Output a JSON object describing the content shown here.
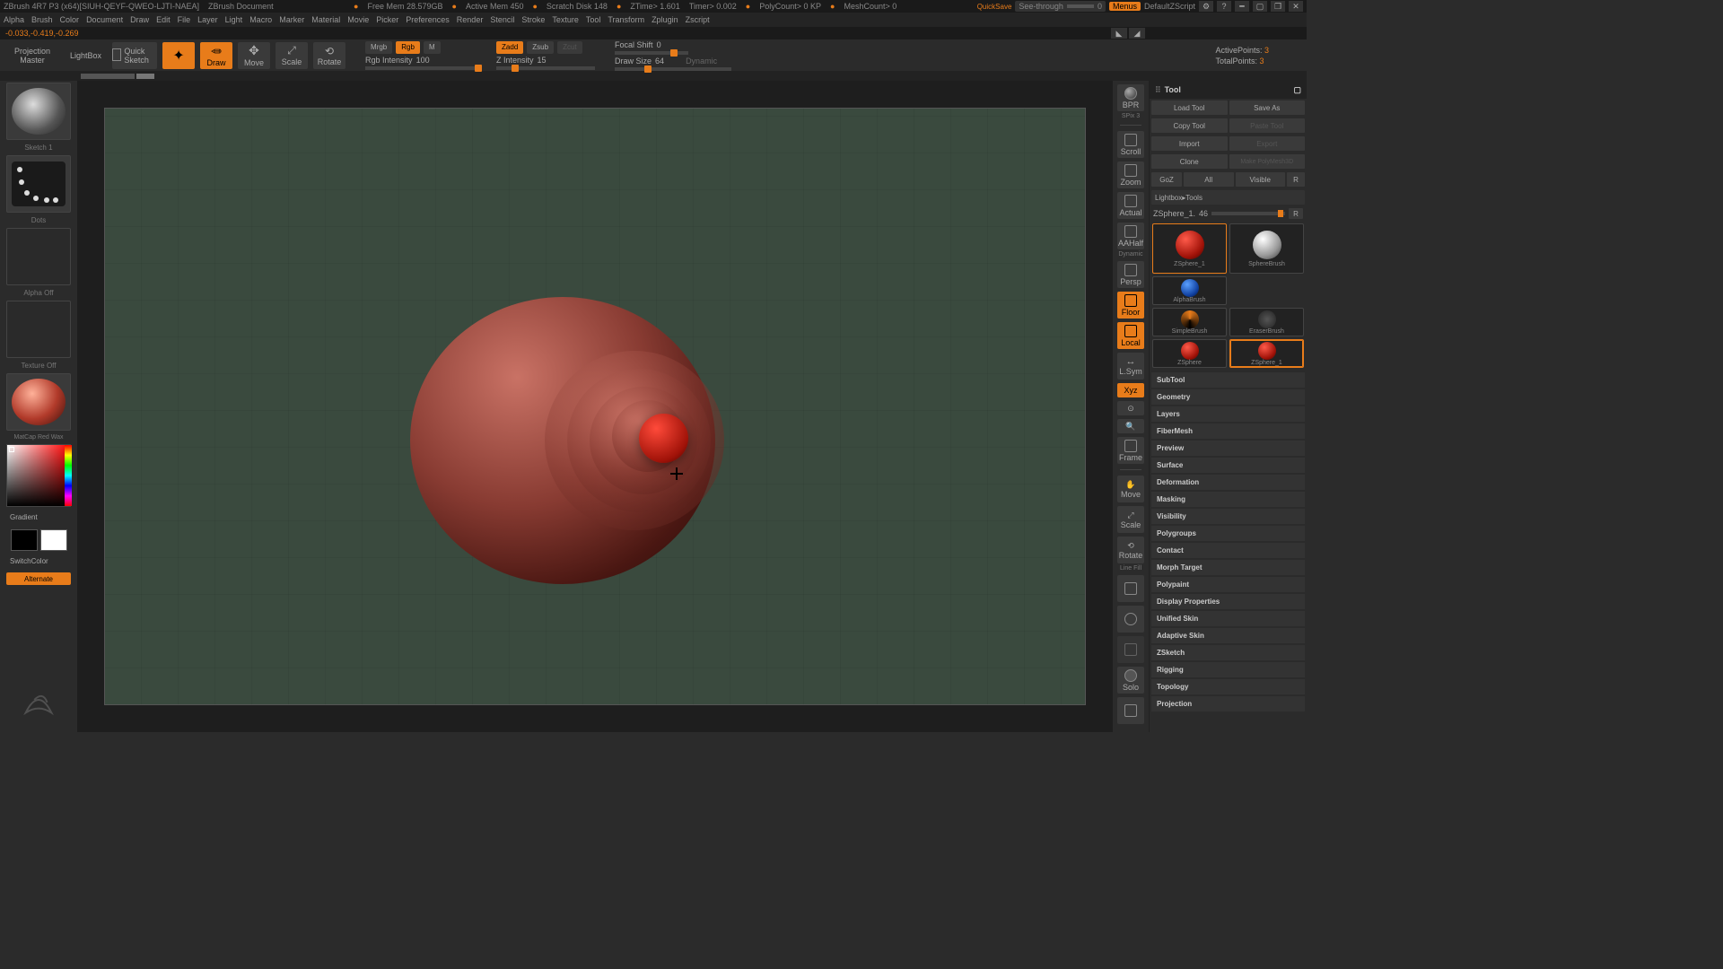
{
  "titlebar": {
    "app": "ZBrush 4R7 P3 (x64)[SIUH-QEYF-QWEO-LJTI-NAEA]",
    "doc": "ZBrush Document",
    "freeMem": "Free Mem 28.579GB",
    "activeMem": "Active Mem 450",
    "scratch": "Scratch Disk 148",
    "ztime": "ZTime> 1.601",
    "timer": "Timer> 0.002",
    "poly": "PolyCount> 0 KP",
    "mesh": "MeshCount> 0",
    "quicksave": "QuickSave",
    "seeThrough": "See-through",
    "seeThroughVal": "0",
    "menus": "Menus",
    "skin": "DefaultZScript"
  },
  "menu": [
    "Alpha",
    "Brush",
    "Color",
    "Document",
    "Draw",
    "Edit",
    "File",
    "Layer",
    "Light",
    "Macro",
    "Marker",
    "Material",
    "Movie",
    "Picker",
    "Preferences",
    "Render",
    "Stencil",
    "Stroke",
    "Texture",
    "Tool",
    "Transform",
    "Zplugin",
    "Zscript"
  ],
  "status": "-0.033,-0.419,-0.269",
  "toolbar": {
    "projection": "Projection Master",
    "lightbox": "LightBox",
    "quicksketch": "Quick Sketch",
    "edit": "Edit",
    "draw": "Draw",
    "move": "Move",
    "scale": "Scale",
    "rotate": "Rotate",
    "mrgb": "Mrgb",
    "rgb": "Rgb",
    "m": "M",
    "rgbIntensity": "Rgb Intensity",
    "rgbIntVal": "100",
    "zadd": "Zadd",
    "zsub": "Zsub",
    "zcut": "Zcut",
    "zIntensity": "Z Intensity",
    "zIntVal": "15",
    "focal": "Focal Shift",
    "focalVal": "0",
    "drawSize": "Draw Size",
    "drawSizeVal": "64",
    "dynamic": "Dynamic",
    "activePts": "ActivePoints:",
    "activePtsVal": "3",
    "totalPts": "TotalPoints:",
    "totalPtsVal": "3"
  },
  "left": {
    "brush": "Sketch 1",
    "stroke": "Dots",
    "alpha": "Alpha Off",
    "texture": "Texture Off",
    "matcap": "MatCap Red Wax",
    "gradient": "Gradient",
    "switchColor": "SwitchColor",
    "alternate": "Alternate"
  },
  "shelf": [
    "BPR",
    "SPix 3",
    "Scroll",
    "Zoom",
    "Actual",
    "AAHalf",
    "Persp",
    "Floor",
    "Local",
    "L.Sym",
    "Xyz",
    "",
    "",
    "Frame",
    "Move",
    "Scale",
    "Rotate",
    "Line Fill",
    "",
    "",
    "Solo",
    ""
  ],
  "shelfDynamic": "Dynamic",
  "rightPanel": {
    "title": "Tool",
    "row1": {
      "load": "Load Tool",
      "save": "Save As"
    },
    "row2": {
      "copy": "Copy Tool",
      "paste": "Paste Tool"
    },
    "row3": {
      "import": "Import",
      "export": "Export"
    },
    "row4": {
      "clone": "Clone",
      "make": "Make PolyMesh3D"
    },
    "row5": {
      "goz": "GoZ",
      "all": "All",
      "vis": "Visible",
      "r": "R"
    },
    "lightboxTools": "Lightbox▸Tools",
    "toolName": "ZSphere_1.",
    "toolNameVal": "46",
    "r": "R",
    "thumbs": [
      "ZSphere_1",
      "SphereBrush",
      "AlphaBrush",
      "SimpleBrush",
      "EraserBrush",
      "ZSphere",
      "ZSphere_1"
    ],
    "sections": [
      "SubTool",
      "Geometry",
      "Layers",
      "FiberMesh",
      "Preview",
      "Surface",
      "Deformation",
      "Masking",
      "Visibility",
      "Polygroups",
      "Contact",
      "Morph Target",
      "Polypaint",
      "Display Properties",
      "Unified Skin",
      "Adaptive Skin",
      "ZSketch",
      "Rigging",
      "Topology",
      "Projection"
    ]
  }
}
